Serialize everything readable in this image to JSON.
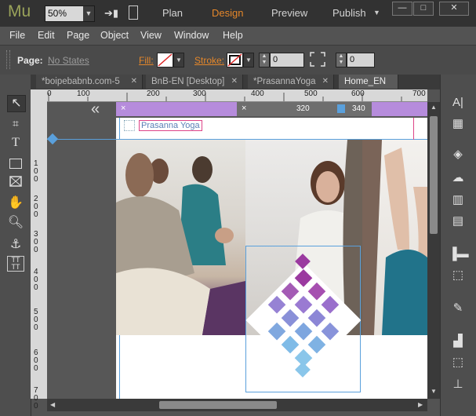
{
  "app": {
    "logo": "Mu",
    "zoom": "50%"
  },
  "workspaces": {
    "plan": "Plan",
    "design": "Design",
    "preview": "Preview",
    "publish": "Publish"
  },
  "window_controls": {
    "minimize": "—",
    "maximize": "□",
    "close": "✕"
  },
  "menu": [
    "File",
    "Edit",
    "Page",
    "Object",
    "View",
    "Window",
    "Help"
  ],
  "control_bar": {
    "page_label": "Page:",
    "state_value": "No States",
    "fill_label": "Fill:",
    "stroke_label": "Stroke:",
    "stroke_width": "0",
    "corner_radius": "0"
  },
  "tabs": [
    {
      "label": "*boipebabnb.com-5",
      "active": false
    },
    {
      "label": "BnB-EN [Desktop]",
      "active": false
    },
    {
      "label": "*PrasannaYoga",
      "active": false
    },
    {
      "label": "Home_EN",
      "active": true
    }
  ],
  "ruler": {
    "h_ticks": [
      "0",
      "100",
      "200",
      "300",
      "400",
      "500",
      "600",
      "700"
    ],
    "v_ticks": [
      "1\n0\n0",
      "2\n0\n0",
      "3\n0\n0",
      "4\n0\n0",
      "5\n0\n0",
      "6\n0\n0",
      "7\n0\n0"
    ]
  },
  "breakpoints": {
    "collapse": "«",
    "left_close": "×",
    "mid_close": "×",
    "value_320": "320",
    "value_340": "340"
  },
  "page": {
    "logo_text": "Prasanna Yoga"
  },
  "colors": {
    "accent_orange": "#e5872a",
    "breakpoint_purple": "#b68cdc",
    "knot_dark": "#9b3aa0",
    "knot_mid": "#8e7ad0",
    "knot_light": "#8ac6ea",
    "selection_blue": "#5aa0dc"
  },
  "icons": {
    "left_tools": [
      "selection-tool-icon",
      "crop-tool-icon",
      "text-tool-icon",
      "rectangle-tool-icon",
      "image-frame-tool-icon",
      "hand-tool-icon",
      "zoom-tool-icon",
      "anchor-icon",
      "text-frames-icon"
    ],
    "right_panels": [
      "character-panel-icon",
      "widgets-panel-icon",
      "layers-panel-icon",
      "cc-libraries-icon",
      "library-panel-icon",
      "assets-panel-icon",
      "align-panel-icon",
      "transform-panel-icon",
      "states-panel-icon",
      "arrange-panel-icon",
      "scale-panel-icon",
      "wrap-panel-icon"
    ]
  }
}
